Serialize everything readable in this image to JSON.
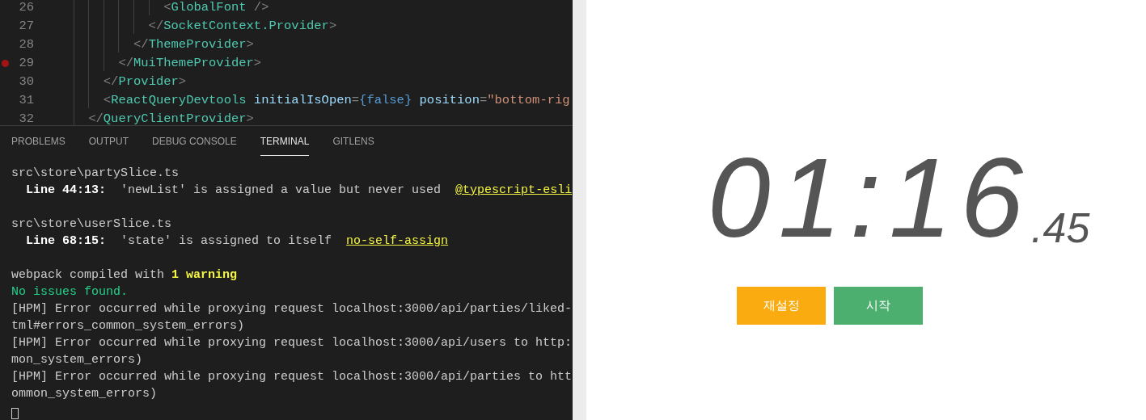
{
  "editor": {
    "lines": [
      {
        "number": "26",
        "breakpoint": false,
        "tokens": [
          {
            "kind": "punct",
            "text": "              <"
          },
          {
            "kind": "tag",
            "text": "GlobalFont"
          },
          {
            "kind": "punct",
            "text": " />"
          }
        ]
      },
      {
        "number": "27",
        "breakpoint": false,
        "tokens": [
          {
            "kind": "punct",
            "text": "            </"
          },
          {
            "kind": "tag",
            "text": "SocketContext.Provider"
          },
          {
            "kind": "punct",
            "text": ">"
          }
        ]
      },
      {
        "number": "28",
        "breakpoint": false,
        "tokens": [
          {
            "kind": "punct",
            "text": "          </"
          },
          {
            "kind": "tag",
            "text": "ThemeProvider"
          },
          {
            "kind": "punct",
            "text": ">"
          }
        ]
      },
      {
        "number": "29",
        "breakpoint": true,
        "tokens": [
          {
            "kind": "punct",
            "text": "        </"
          },
          {
            "kind": "tag",
            "text": "MuiThemeProvider"
          },
          {
            "kind": "punct",
            "text": ">"
          }
        ]
      },
      {
        "number": "30",
        "breakpoint": false,
        "tokens": [
          {
            "kind": "punct",
            "text": "      </"
          },
          {
            "kind": "tag",
            "text": "Provider"
          },
          {
            "kind": "punct",
            "text": ">"
          }
        ]
      },
      {
        "number": "31",
        "breakpoint": false,
        "tokens": [
          {
            "kind": "punct",
            "text": "      <"
          },
          {
            "kind": "tag",
            "text": "ReactQueryDevtools"
          },
          {
            "kind": "attr",
            "text": " initialIsOpen"
          },
          {
            "kind": "punct",
            "text": "="
          },
          {
            "kind": "keyword",
            "text": "{false}"
          },
          {
            "kind": "attr",
            "text": " position"
          },
          {
            "kind": "punct",
            "text": "="
          },
          {
            "kind": "string",
            "text": "\"bottom-rig"
          }
        ]
      },
      {
        "number": "32",
        "breakpoint": false,
        "tokens": [
          {
            "kind": "punct",
            "text": "    </"
          },
          {
            "kind": "tag",
            "text": "QueryClientProvider"
          },
          {
            "kind": "punct",
            "text": ">"
          }
        ]
      }
    ]
  },
  "panel_tabs": [
    {
      "label": "PROBLEMS",
      "selected": false
    },
    {
      "label": "OUTPUT",
      "selected": false
    },
    {
      "label": "DEBUG CONSOLE",
      "selected": false
    },
    {
      "label": "TERMINAL",
      "selected": true
    },
    {
      "label": "GITLENS",
      "selected": false
    }
  ],
  "terminal": {
    "lines": [
      {
        "kind": "text",
        "segments": [
          {
            "kind": "plain",
            "text": "src\\store\\partySlice.ts"
          }
        ]
      },
      {
        "kind": "text",
        "segments": [
          {
            "kind": "bold",
            "text": "  Line 44:13:"
          },
          {
            "kind": "plain",
            "text": "  'newList' is assigned a value but never used  "
          },
          {
            "kind": "link",
            "text": "@typescript-esli"
          }
        ]
      },
      {
        "kind": "blank"
      },
      {
        "kind": "text",
        "segments": [
          {
            "kind": "plain",
            "text": "src\\store\\userSlice.ts"
          }
        ]
      },
      {
        "kind": "text",
        "segments": [
          {
            "kind": "bold",
            "text": "  Line 68:15:"
          },
          {
            "kind": "plain",
            "text": "  'state' is assigned to itself  "
          },
          {
            "kind": "link",
            "text": "no-self-assign"
          }
        ]
      },
      {
        "kind": "blank"
      },
      {
        "kind": "text",
        "segments": [
          {
            "kind": "plain",
            "text": "webpack compiled with "
          },
          {
            "kind": "warn",
            "text": "1 warning"
          }
        ]
      },
      {
        "kind": "text",
        "segments": [
          {
            "kind": "success",
            "text": "No issues found."
          }
        ]
      },
      {
        "kind": "text",
        "segments": [
          {
            "kind": "plain",
            "text": "[HPM] Error occurred while proxying request localhost:3000/api/parties/liked-"
          }
        ]
      },
      {
        "kind": "text",
        "segments": [
          {
            "kind": "plain",
            "text": "tml#errors_common_system_errors)"
          }
        ]
      },
      {
        "kind": "text",
        "segments": [
          {
            "kind": "plain",
            "text": "[HPM] Error occurred while proxying request localhost:3000/api/users to http:"
          }
        ]
      },
      {
        "kind": "text",
        "segments": [
          {
            "kind": "plain",
            "text": "mon_system_errors)"
          }
        ]
      },
      {
        "kind": "text",
        "segments": [
          {
            "kind": "plain",
            "text": "[HPM] Error occurred while proxying request localhost:3000/api/parties to htt"
          }
        ]
      },
      {
        "kind": "text",
        "segments": [
          {
            "kind": "plain",
            "text": "ommon_system_errors)"
          }
        ]
      },
      {
        "kind": "cursor"
      }
    ]
  },
  "stopwatch": {
    "time": "01:16",
    "fraction": ".45",
    "buttons": [
      {
        "label": "재설정",
        "kind": "reset"
      },
      {
        "label": "시작",
        "kind": "start"
      }
    ]
  }
}
